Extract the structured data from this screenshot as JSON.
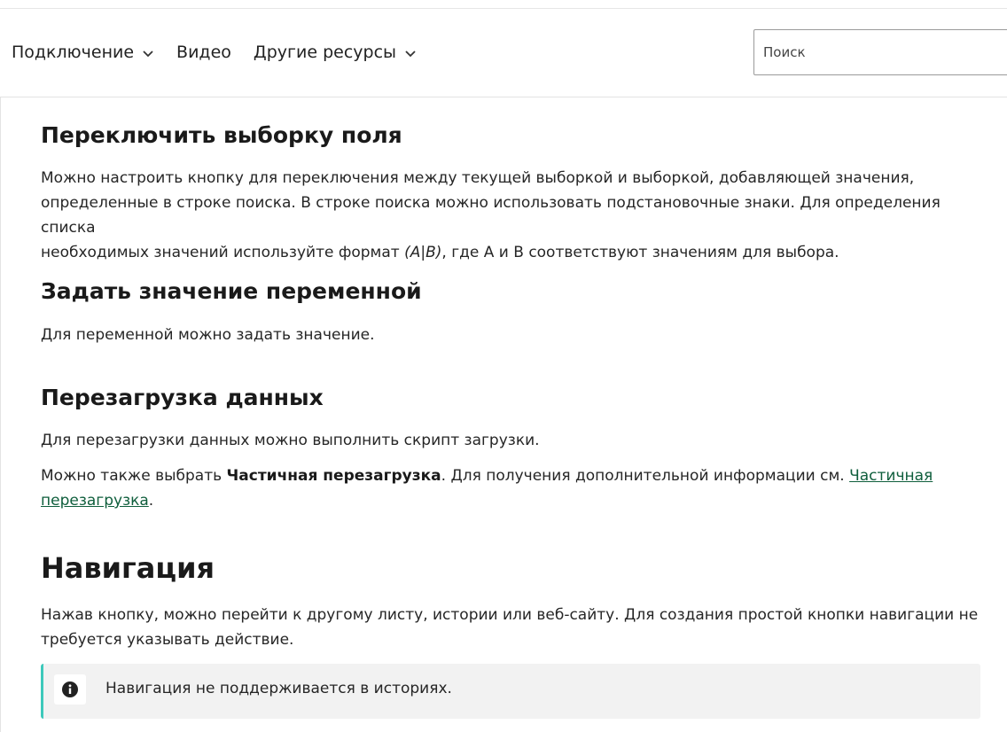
{
  "header": {
    "nav": [
      {
        "label": "Подключение",
        "dropdown": true
      },
      {
        "label": "Видео",
        "dropdown": false
      },
      {
        "label": "Другие ресурсы",
        "dropdown": true
      }
    ],
    "search_placeholder": "Поиск"
  },
  "sections": {
    "toggle": {
      "heading": "Переключить выборку поля",
      "text_1": "Можно настроить кнопку для переключения между текущей выборкой и выборкой, добавляющей значения,",
      "text_2": "определенные в строке поиска. В строке поиска можно использовать подстановочные знаки. Для определения списка",
      "text_3a": "необходимых значений используйте формат ",
      "text_3_format": "(A|B)",
      "text_3b": ", где A и B соответствуют значениям для выбора."
    },
    "variable": {
      "heading": "Задать значение переменной",
      "text": "Для переменной можно задать значение."
    },
    "reload": {
      "heading": "Перезагрузка данных",
      "text": "Для перезагрузки данных можно выполнить скрипт загрузки.",
      "text2_a": "Можно также выбрать ",
      "text2_bold": "Частичная перезагрузка",
      "text2_b": ". Для получения дополнительной информации см. ",
      "link_part1": "Частичная",
      "link_part2": "перезагрузка",
      "text2_end": "."
    },
    "navigation": {
      "heading": "Навигация",
      "text_1": "Нажав кнопку, можно перейти к другому листу, истории или веб-сайту. Для создания простой кнопки навигации не",
      "text_2": "требуется указывать действие.",
      "note": "Навигация не поддерживается в историях."
    }
  },
  "colors": {
    "link": "#0f5e3c",
    "note_accent": "#3ec9bb",
    "note_bg": "#f2f2f2"
  },
  "icons": {
    "chevron": "chevron-down-icon",
    "note": "info-icon"
  }
}
